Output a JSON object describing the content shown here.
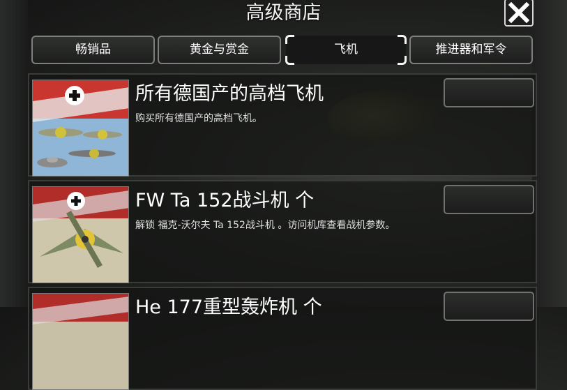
{
  "header": {
    "title": "高级商店",
    "close_icon": "close-icon"
  },
  "tabs": [
    {
      "label": "畅销品",
      "active": false
    },
    {
      "label": "黄金与赏金",
      "active": false
    },
    {
      "label": "飞机",
      "active": true
    },
    {
      "label": "推进器和军令",
      "active": false
    }
  ],
  "items": [
    {
      "title": "所有德国产的高档飞机",
      "desc": "购买所有德国产的高档飞机。",
      "thumb_icon": "german-aircraft-pack-icon"
    },
    {
      "title": "FW Ta 152战斗机 个",
      "desc": "解锁 福克-沃尔夫 Ta 152战斗机 。访问机库查看战机参数。",
      "thumb_icon": "fw-ta152-fighter-icon"
    },
    {
      "title": "He 177重型轰炸机 个",
      "desc": "",
      "thumb_icon": "he177-bomber-icon"
    }
  ],
  "colors": {
    "panel": "#141514",
    "border": "#7c7f7c",
    "flag_red": "#b22a2a"
  }
}
